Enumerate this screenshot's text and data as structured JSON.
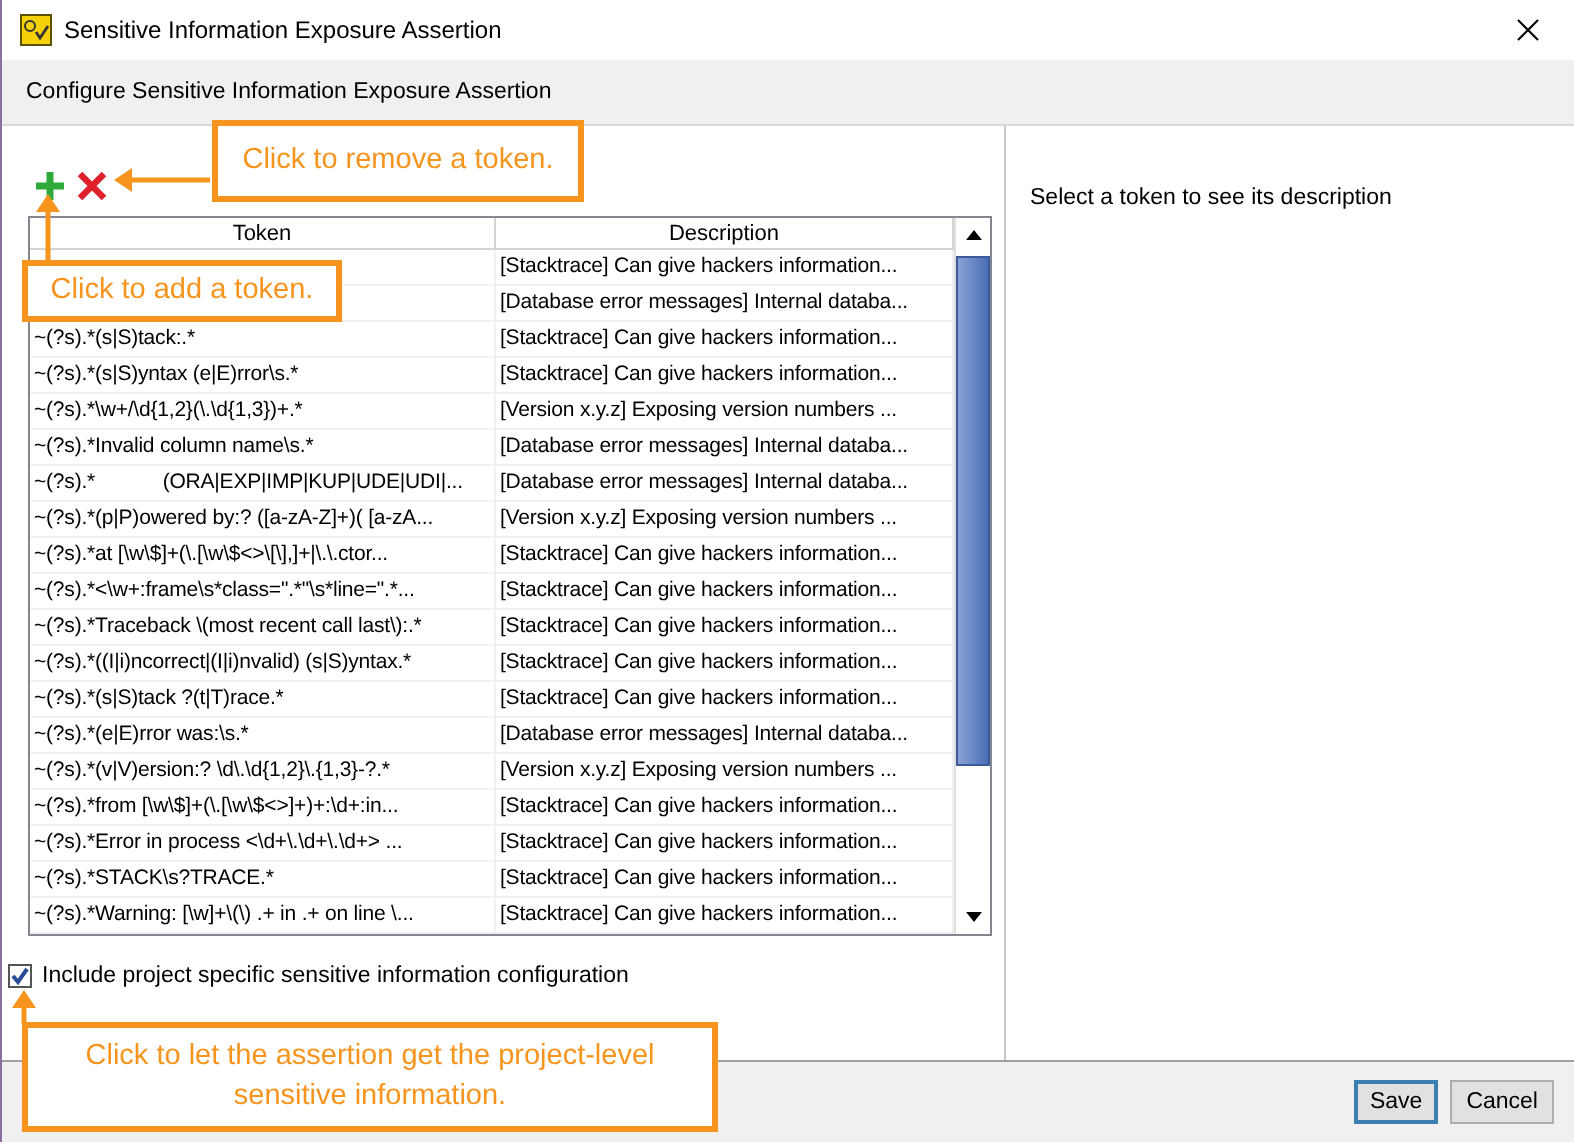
{
  "window": {
    "title": "Sensitive Information Exposure Assertion"
  },
  "header": "Configure Sensitive Information Exposure Assertion",
  "table": {
    "columns": [
      "Token",
      "Description"
    ],
    "rows": [
      {
        "description": "[Stacktrace] Can give hackers information..."
      },
      {
        "description": "[Database error messages] Internal databa..."
      },
      {
        "token": "~(?s).*(s|S)tack:.*",
        "description": "[Stacktrace] Can give hackers information..."
      },
      {
        "token": "~(?s).*(s|S)yntax (e|E)rror\\s.*",
        "description": "[Stacktrace] Can give hackers information..."
      },
      {
        "token": "~(?s).*\\w+/\\d{1,2}(\\.\\d{1,3})+.*",
        "description": "[Version x.y.z] Exposing version numbers ..."
      },
      {
        "token": "~(?s).*Invalid column name\\s.*",
        "description": "[Database error messages] Internal databa..."
      },
      {
        "token": "~(?s).*            (ORA|EXP|IMP|KUP|UDE|UDI|...",
        "description": "[Database error messages] Internal databa..."
      },
      {
        "token": "~(?s).*(p|P)owered by:? ([a-zA-Z]+)( [a-zA...",
        "description": "[Version x.y.z] Exposing version numbers ..."
      },
      {
        "token": "~(?s).*at [\\w\\$]+(\\.[\\w\\$<>\\[\\],]+|\\.\\.ctor...",
        "description": "[Stacktrace] Can give hackers information..."
      },
      {
        "token": "~(?s).*<\\w+:frame\\s*class=\".*\"\\s*line=\".*...",
        "description": "[Stacktrace] Can give hackers information..."
      },
      {
        "token": "~(?s).*Traceback \\(most recent call last\\):.*",
        "description": "[Stacktrace] Can give hackers information..."
      },
      {
        "token": "~(?s).*((I|i)ncorrect|(I|i)nvalid) (s|S)yntax.*",
        "description": "[Stacktrace] Can give hackers information..."
      },
      {
        "token": "~(?s).*(s|S)tack ?(t|T)race.*",
        "description": "[Stacktrace] Can give hackers information..."
      },
      {
        "token": "~(?s).*(e|E)rror was:\\s.*",
        "description": "[Database error messages] Internal databa..."
      },
      {
        "token": "~(?s).*(v|V)ersion:? \\d\\.\\d{1,2}\\.{1,3}-?.*",
        "description": "[Version x.y.z] Exposing version numbers ..."
      },
      {
        "token": "~(?s).*from [\\w\\$]+(\\.[\\w\\$<>]+)+:\\d+:in...",
        "description": "[Stacktrace] Can give hackers information..."
      },
      {
        "token": "~(?s).*Error in process <\\d+\\.\\d+\\.\\d+> ...",
        "description": "[Stacktrace] Can give hackers information..."
      },
      {
        "token": "~(?s).*STACK\\s?TRACE.*",
        "description": "[Stacktrace] Can give hackers information..."
      },
      {
        "token": "~(?s).*Warning: [\\w]+\\(\\) .+ in .+ on line \\...",
        "description": "[Stacktrace] Can give hackers information..."
      }
    ]
  },
  "include_project": {
    "label": "Include project specific sensitive information configuration",
    "checked": true
  },
  "description_panel": "Select a token to see its description",
  "buttons": [
    "Save",
    "Cancel"
  ],
  "callouts": [
    "Click to remove a token.",
    "Click to add a token.",
    "Click to let the assertion get the project-level sensitive information."
  ]
}
